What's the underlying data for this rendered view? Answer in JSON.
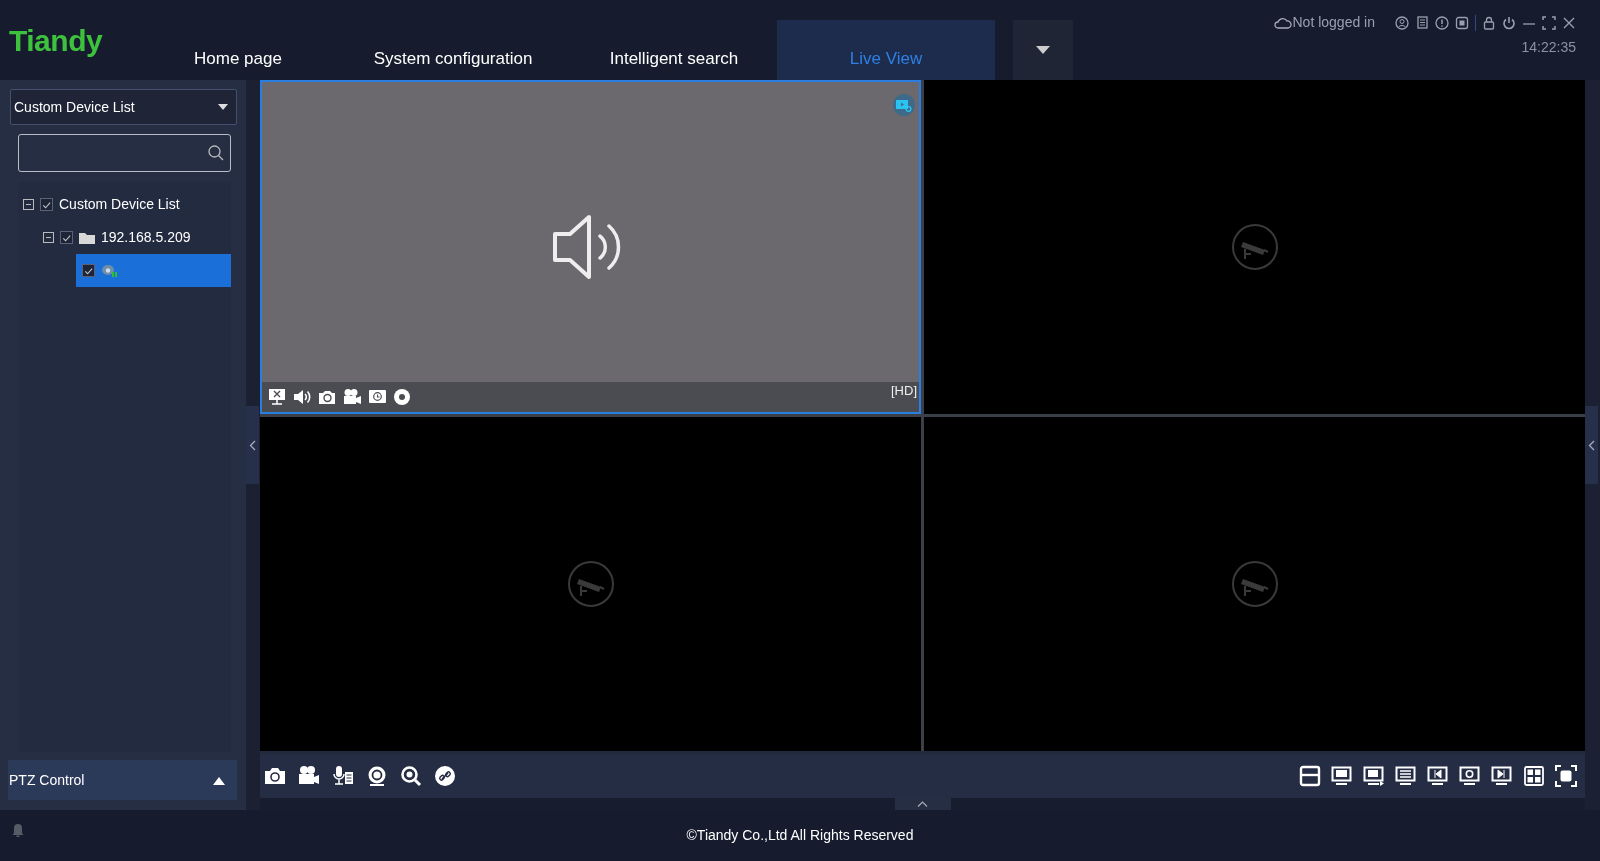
{
  "header": {
    "logo": "Tiandy",
    "tabs": [
      {
        "label": "Home page",
        "selected": false
      },
      {
        "label": "System configuration",
        "selected": false
      },
      {
        "label": "Intelligent search",
        "selected": false
      },
      {
        "label": "Live View",
        "selected": true
      }
    ],
    "login_status": "Not logged in",
    "time": "14:22:35"
  },
  "sidebar": {
    "device_list_select": "Custom Device List",
    "tree": [
      {
        "label": "Custom Device List",
        "expanded": true,
        "checked": true,
        "selected": false,
        "children": [
          {
            "label": "192.168.5.209",
            "kind": "folder",
            "expanded": true,
            "checked": true,
            "selected": false,
            "children": [
              {
                "kind": "camera",
                "checked": true,
                "selected": true
              }
            ]
          }
        ]
      }
    ],
    "ptz_panel": {
      "label": "PTZ Control",
      "expanded": false
    }
  },
  "video_panes": [
    {
      "kind": "audio",
      "selected": true,
      "quality": "[HD]"
    },
    {
      "kind": "empty",
      "selected": false
    },
    {
      "kind": "empty",
      "selected": false
    },
    {
      "kind": "empty",
      "selected": false
    }
  ],
  "footer": {
    "copyright": "©Tiandy Co.,Ltd All Rights Reserved"
  }
}
